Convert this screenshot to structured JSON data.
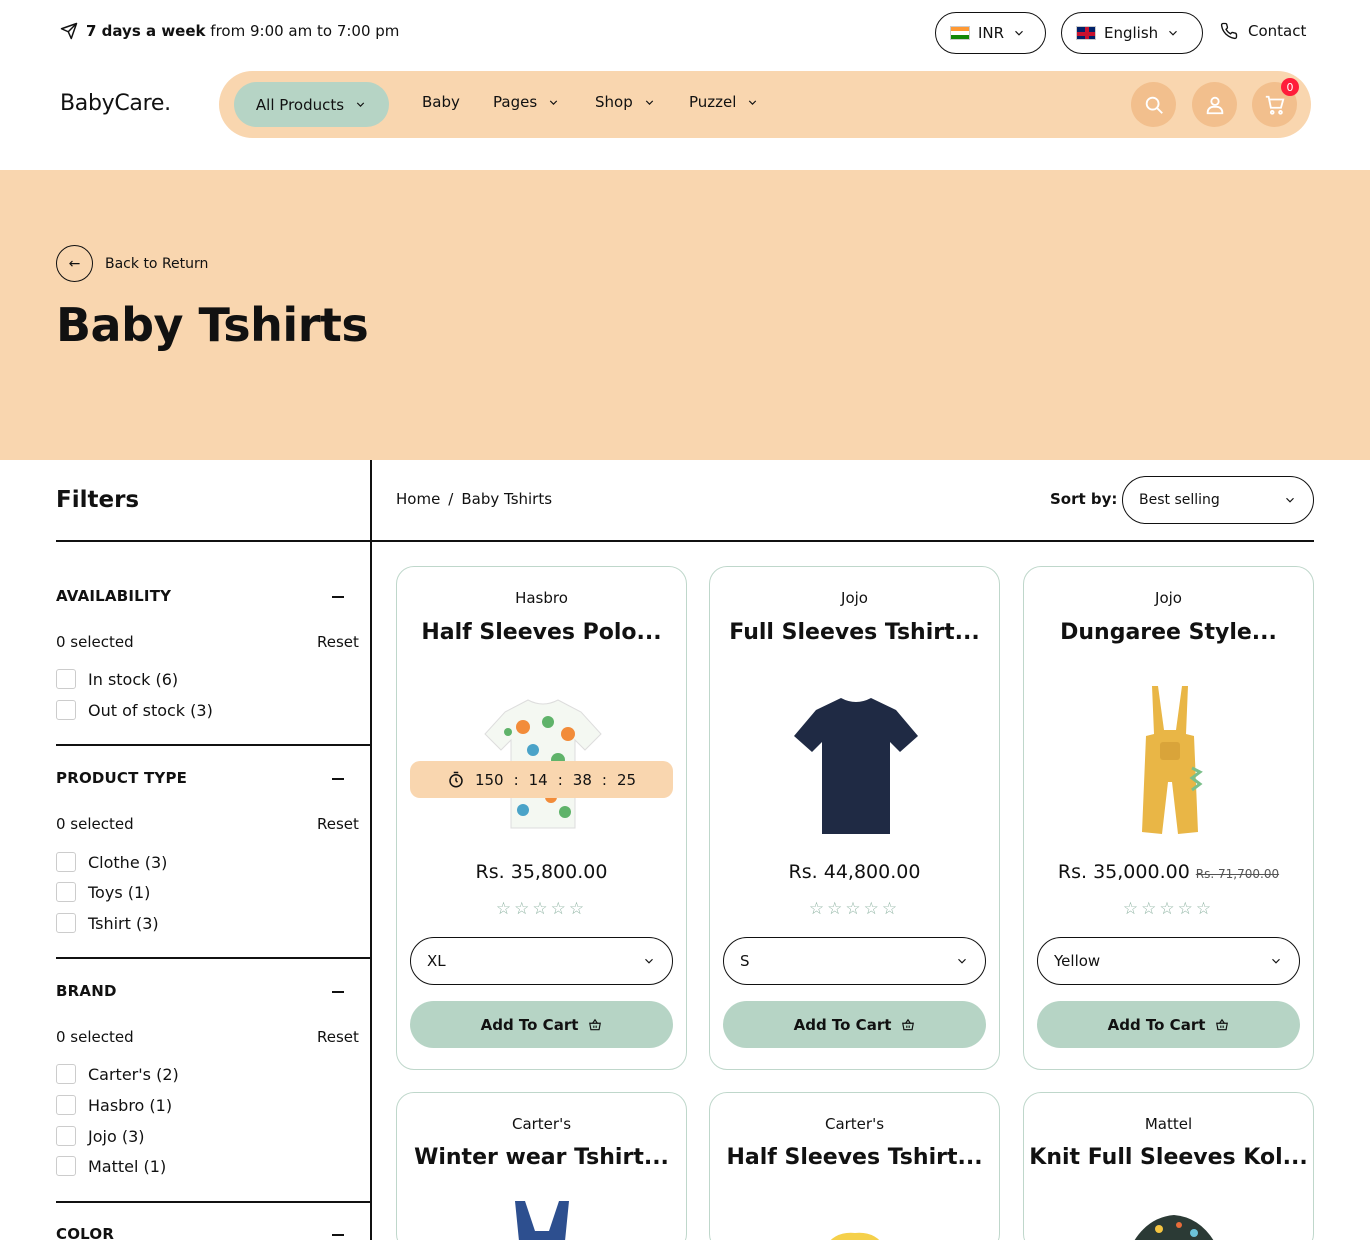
{
  "topbar": {
    "hours_bold": "7 days a week",
    "hours_rest": "from 9:00 am to 7:00 pm",
    "currency": "INR",
    "language": "English",
    "contact": "Contact"
  },
  "header": {
    "logo": "BabyCare.",
    "nav": {
      "all_products": "All Products",
      "baby": "Baby",
      "pages": "Pages",
      "shop": "Shop",
      "puzzel": "Puzzel"
    },
    "cart_count": "0"
  },
  "hero": {
    "back_label": "Back to Return",
    "title": "Baby Tshirts"
  },
  "filters": {
    "title": "Filters",
    "sections": [
      {
        "title": "AVAILABILITY",
        "selected": "0 selected",
        "reset": "Reset",
        "options": [
          "In stock (6)",
          "Out of stock (3)"
        ]
      },
      {
        "title": "PRODUCT TYPE",
        "selected": "0 selected",
        "reset": "Reset",
        "options": [
          "Clothe (3)",
          "Toys (1)",
          "Tshirt (3)"
        ]
      },
      {
        "title": "BRAND",
        "selected": "0 selected",
        "reset": "Reset",
        "options": [
          "Carter's (2)",
          "Hasbro (1)",
          "Jojo (3)",
          "Mattel (1)"
        ]
      },
      {
        "title": "COLOR"
      }
    ]
  },
  "toolbar": {
    "breadcrumb_home": "Home",
    "breadcrumb_sep": "/",
    "breadcrumb_current": "Baby Tshirts",
    "sort_label": "Sort by:",
    "sort_value": "Best selling"
  },
  "products": [
    {
      "brand": "Hasbro",
      "name": "Half Sleeves Polo...",
      "price": "Rs. 35,800.00",
      "old_price": "",
      "variant": "XL",
      "add_label": "Add To Cart",
      "timer": {
        "days": "150",
        "hours": "14",
        "minutes": "38",
        "seconds": "25",
        "sep": ":"
      }
    },
    {
      "brand": "Jojo",
      "name": "Full Sleeves Tshirt...",
      "price": "Rs. 44,800.00",
      "old_price": "",
      "variant": "S",
      "add_label": "Add To Cart"
    },
    {
      "brand": "Jojo",
      "name": "Dungaree Style...",
      "price": "Rs. 35,000.00",
      "old_price": "Rs. 71,700.00",
      "variant": "Yellow",
      "add_label": "Add To Cart"
    },
    {
      "brand": "Carter's",
      "name": "Winter wear Tshirt..."
    },
    {
      "brand": "Carter's",
      "name": "Half Sleeves Tshirt..."
    },
    {
      "brand": "Mattel",
      "name": "Knit Full Sleeves Kol..."
    }
  ],
  "rating": "☆☆☆☆☆",
  "colors": {
    "peach": "#f9d6af",
    "mint": "#b6d4c5",
    "icon_circle": "#f2bf8d",
    "badge": "#ff1d3a"
  }
}
